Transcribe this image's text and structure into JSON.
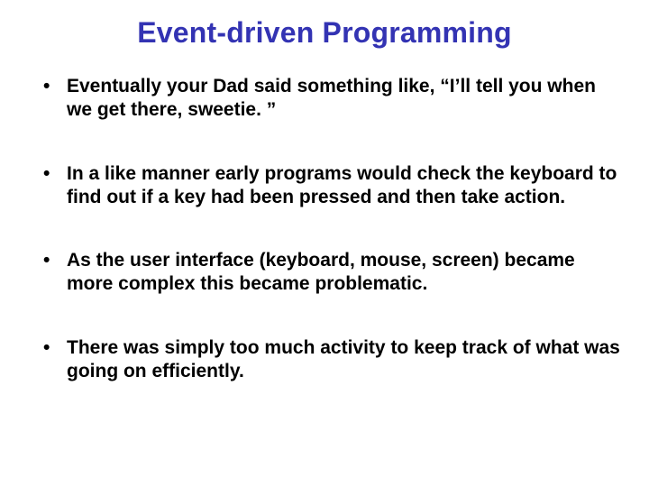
{
  "slide": {
    "title": "Event-driven Programming",
    "bullets": [
      "Eventually your Dad said something like, “I’ll tell you when we get there, sweetie. ”",
      "In a like manner early programs would check the keyboard to find out if a key had been pressed and then take action.",
      "As the user interface (keyboard, mouse, screen) became more complex this became problematic.",
      "There was simply too much activity to keep track of what was going on efficiently."
    ]
  }
}
